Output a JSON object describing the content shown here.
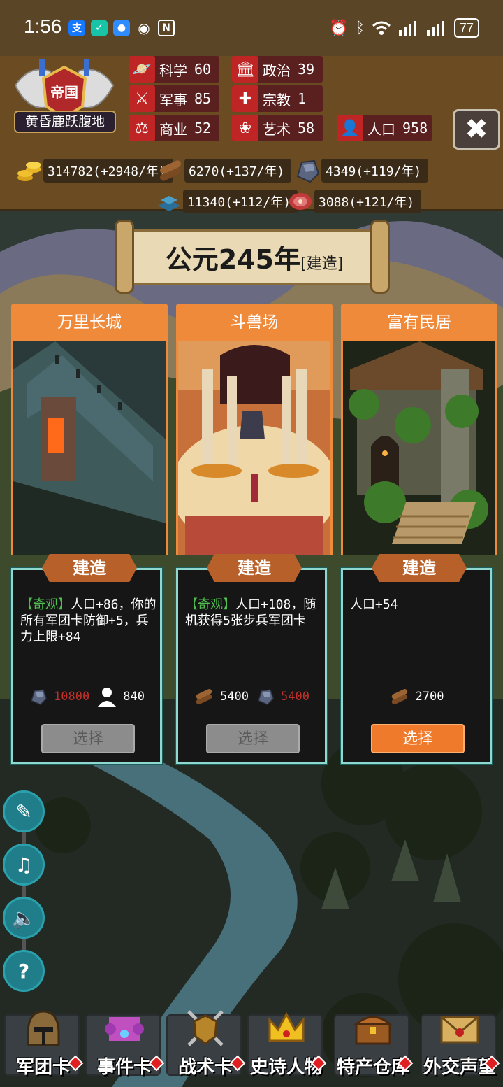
{
  "status_bar": {
    "time": "1:56",
    "battery": "77",
    "left_icons": [
      "alipay-icon",
      "shield-app-icon",
      "message-app-icon",
      "eye-icon",
      "nfc-icon"
    ],
    "right_icons": [
      "alarm-icon",
      "bluetooth-icon",
      "wifi-icon",
      "signal-icon",
      "signal-icon",
      "battery-icon"
    ]
  },
  "empire": {
    "title": "帝国",
    "name": "黄昏鹿跃腹地"
  },
  "stats": [
    {
      "label": "科学",
      "value": "60",
      "icon": "planet-icon"
    },
    {
      "label": "政治",
      "value": "39",
      "icon": "capitol-icon"
    },
    {
      "label": "军事",
      "value": "85",
      "icon": "crossed-swords-icon"
    },
    {
      "label": "宗教",
      "value": "1",
      "icon": "cross-icon"
    },
    {
      "label": "商业",
      "value": "52",
      "icon": "scales-icon"
    },
    {
      "label": "艺术",
      "value": "58",
      "icon": "lotus-icon"
    },
    {
      "label": "人口",
      "value": "958",
      "icon": "person-icon"
    }
  ],
  "resources": [
    {
      "value": "314782(+2948/年)",
      "icon": "gold-coins-icon"
    },
    {
      "value": "6270(+137/年)",
      "icon": "wood-logs-icon"
    },
    {
      "value": "4349(+119/年)",
      "icon": "stone-ore-icon"
    },
    {
      "value": "11340(+112/年)",
      "icon": "iron-ingot-icon"
    },
    {
      "value": "3088(+121/年)",
      "icon": "meat-icon"
    }
  ],
  "banner": {
    "year": "公元245年",
    "phase": "[建造]"
  },
  "cards": [
    {
      "title": "万里长城",
      "build_label": "建造",
      "tag": "【奇观】",
      "desc": "人口+86，你的所有军团卡防御+5，兵力上限+84",
      "costs": [
        {
          "icon": "stone-ore-icon",
          "value": "10800",
          "insufficient": true
        },
        {
          "icon": "person-icon",
          "value": "840",
          "insufficient": false
        }
      ],
      "select_label": "选择",
      "enabled": false
    },
    {
      "title": "斗兽场",
      "build_label": "建造",
      "tag": "【奇观】",
      "desc": "人口+108，随机获得5张步兵军团卡",
      "costs": [
        {
          "icon": "wood-logs-icon",
          "value": "5400",
          "insufficient": false
        },
        {
          "icon": "stone-ore-icon",
          "value": "5400",
          "insufficient": true
        }
      ],
      "select_label": "选择",
      "enabled": false
    },
    {
      "title": "富有民居",
      "build_label": "建造",
      "tag": "",
      "desc": "人口+54",
      "costs": [
        {
          "icon": "wood-logs-icon",
          "value": "2700",
          "insufficient": false
        }
      ],
      "select_label": "选择",
      "enabled": true
    }
  ],
  "side_buttons": [
    "book-quill-icon",
    "music-note-icon",
    "speaker-icon",
    "help-icon"
  ],
  "bottom_nav": [
    {
      "label": "军团卡",
      "icon": "helmet-icon"
    },
    {
      "label": "事件卡",
      "icon": "scroll-icon"
    },
    {
      "label": "战术卡",
      "icon": "shield-swords-icon"
    },
    {
      "label": "史诗人物",
      "icon": "crown-icon"
    },
    {
      "label": "特产仓库",
      "icon": "treasure-chest-icon"
    },
    {
      "label": "外交声望",
      "icon": "envelope-icon"
    }
  ],
  "colors": {
    "header_bg": "#6b4b22",
    "stat_icon_red": "#c02525",
    "card_header_orange": "#f08a3b",
    "card_border_cyan": "#8fd8d0",
    "select_active": "#f07a2b",
    "wonder_green": "#4fc04f",
    "insufficient_red": "#c0302a"
  }
}
